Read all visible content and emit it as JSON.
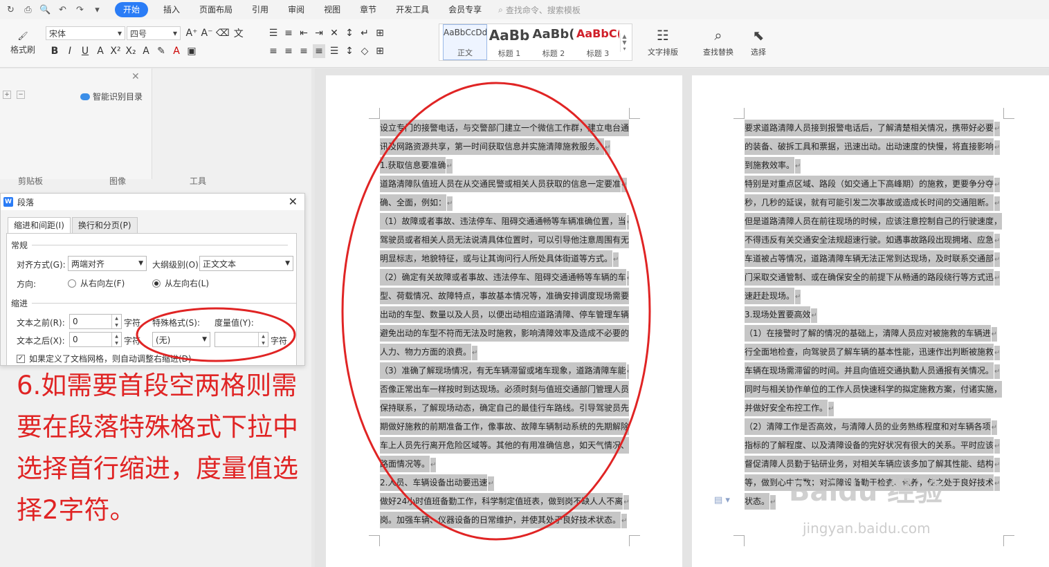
{
  "menubar": {
    "quick_access": [
      "↻",
      "⎙",
      "🔍",
      "↶",
      "↷",
      "▾"
    ],
    "tabs": [
      "开始",
      "插入",
      "页面布局",
      "引用",
      "审阅",
      "视图",
      "章节",
      "开发工具",
      "会员专享"
    ],
    "search_placeholder": "查找命令、搜索模板"
  },
  "ribbon": {
    "format_painter": "格式刷",
    "font_name": "宋体",
    "font_size": "四号",
    "styles": [
      {
        "sample": "AaBbCcDd",
        "label": "正文"
      },
      {
        "sample": "AaBb",
        "label": "标题 1"
      },
      {
        "sample": "AaBb(",
        "label": "标题 2"
      },
      {
        "sample": "AaBbC(",
        "label": "标题 3"
      }
    ],
    "text_layout": "文字排版",
    "find_replace": "查找替换",
    "select": "选择",
    "groups": {
      "clipboard": "剪贴板",
      "image": "图像",
      "tools": "工具"
    }
  },
  "toc": {
    "smart": "智能识别目录"
  },
  "dialog": {
    "title": "段落",
    "tabs": [
      "缩进和间距(I)",
      "换行和分页(P)"
    ],
    "general": "常规",
    "align_label": "对齐方式(G):",
    "align_value": "两端对齐",
    "outline_label": "大纲级别(O):",
    "outline_value": "正文文本",
    "direction_label": "方向:",
    "rtl": "从右向左(F)",
    "ltr": "从左向右(L)",
    "indent": "缩进",
    "before_label": "文本之前(R):",
    "before_value": "0",
    "after_label": "文本之后(X):",
    "after_value": "0",
    "unit": "字符",
    "special_label": "特殊格式(S):",
    "special_value": "(无)",
    "measure_label": "度量值(Y):",
    "measure_value": "",
    "grid_check": "如果定义了文档网格，则自动调整右缩进(D)"
  },
  "annotation": "6.如需要首段空两格则需要在段落特殊格式下拉中选择首行缩进，度量值选择2字符。",
  "page_left_lines": [
    "设立专门的接警电话，与交警部门建立一个微信工作群，建立电台通",
    "讯及网路资源共享，第一时间获取信息并实施清障施救服务。",
    "1.获取信息要准确",
    "道路清障队值班人员在从交通民警或相关人员获取的信息一定要准",
    "确、全面，例如：",
    "（1）故障或者事故、违法停车、阻碍交通通畅等车辆准确位置，当",
    "驾驶员或者相关人员无法说清具体位置时，可以引导他注意周围有无",
    "明显标志，地貌特征，或与让其询问行人所处具体街道等方式。",
    "（2）确定有关故障或者事故、违法停车、阻碍交通通畅等车辆的车",
    "型、荷载情况、故障特点，事故基本情况等，准确安排调度现场需要",
    "出动的车型、数量以及人员，以便出动相应道路清障、停车管理车辆，",
    "避免出动的车型不符而无法及时施救，影响清障效率及造成不必要的",
    "人力、物力方面的浪费。",
    "（3）准确了解现场情况，有无车辆滞留或堵车现象，道路清障车能",
    "否像正常出车一样按时到达现场。必须时刻与值班交通部门管理人员",
    "保持联系，了解现场动态，确定自己的最佳行车路线。引导驾驶员先",
    "期做好施救的前期准备工作，像事故、故障车辆制动系统的先期解除",
    "车上人员先行离开危险区域等。其他的有用准确信息，如天气情况、",
    "路面情况等。",
    "2.人员、车辆设备出动要迅速",
    "做好24小时值班备勤工作，科学制定值班表，做到岗不缺人人不离",
    "岗。加强车辆、仪器设备的日常维护，并使其处于良好技术状态。"
  ],
  "page_right_lines": [
    "要求道路清障人员接到报警电话后，了解清楚相关情况，携带好必要",
    "的装备、破拆工具和票据，迅速出动。出动速度的快慢，将直接影响",
    "到施救效率。",
    "特别是对重点区域、路段（如交通上下高峰期）的施救，更要争分夺",
    "秒，几秒的延误，就有可能引发二次事故或造成长时间的交通阻断。",
    "但是道路清障人员在前往现场的时候，应该注意控制自己的行驶速度，",
    "不得违反有关交通安全法规超速行驶。如遇事故路段出现拥堵、应急",
    "车道被占等情况，道路清障车辆无法正常到达现场，及时联系交通部",
    "门采取交通管制、或在确保安全的前提下从畅通的路段绕行等方式迅",
    "速赶赴现场。",
    "3.现场处置要高效",
    "（1）在接警时了解的情况的基础上，清障人员应对被施救的车辆进",
    "行全面地检查，向驾驶员了解车辆的基本性能，迅速作出判断被施救",
    "车辆在现场需滞留的时间。并且向值班交通执勤人员通报有关情况。",
    "同时与相关协作单位的工作人员快速科学的拟定施救方案，付诸实施，",
    "并做好安全布控工作。",
    "（2）清障工作是否高效，与清障人员的业务熟练程度和对车辆各项",
    "指标的了解程度、以及清障设备的完好状况有很大的关系。平时应该",
    "督促清障人员勤于钻研业务，对相关车辆应该多加了解其性能、结构",
    "等，做到心中有数；对清障设备勤于检查、保养，使之处于良好技术",
    "状态。"
  ],
  "watermark": {
    "brand": "Baidu 经验",
    "url": "jingyan.baidu.com"
  },
  "colors": {
    "accent": "#2a7cf6",
    "annotation_red": "#e02424",
    "highlight": "#c6c6c6"
  }
}
